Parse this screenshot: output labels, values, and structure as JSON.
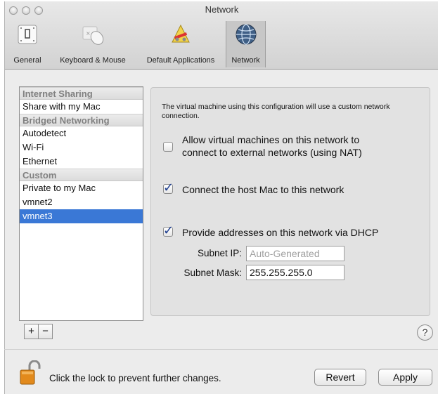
{
  "window": {
    "title": "Network"
  },
  "toolbar": {
    "items": [
      {
        "label": "General",
        "icon": "general-icon"
      },
      {
        "label": "Keyboard & Mouse",
        "icon": "keyboard-mouse-icon"
      },
      {
        "label": "Default Applications",
        "icon": "default-applications-icon"
      },
      {
        "label": "Network",
        "icon": "network-globe-icon",
        "selected": true
      }
    ]
  },
  "network_list": {
    "groups": [
      {
        "header": "Internet Sharing",
        "items": [
          "Share with my Mac"
        ]
      },
      {
        "header": "Bridged Networking",
        "items": [
          "Autodetect",
          "Wi-Fi",
          "Ethernet"
        ]
      },
      {
        "header": "Custom",
        "items": [
          "Private to my Mac",
          "vmnet2",
          "vmnet3"
        ]
      }
    ],
    "selected": "vmnet3",
    "add_label": "+",
    "remove_label": "−"
  },
  "settings": {
    "description": "The virtual machine using this configuration will use a custom network connection.",
    "options": [
      {
        "label": "Allow virtual machines on this network to connect to external networks (using NAT)",
        "checked": false
      },
      {
        "label": "Connect the host Mac to this network",
        "checked": true
      },
      {
        "label": "Provide addresses on this network via DHCP",
        "checked": true
      }
    ],
    "subnet_ip_label": "Subnet IP:",
    "subnet_ip_placeholder": "Auto-Generated",
    "subnet_mask_label": "Subnet Mask:",
    "subnet_mask_value": "255.255.255.0",
    "checkmark": "✓"
  },
  "footer": {
    "help_label": "?",
    "lock_text": "Click the lock to prevent further changes.",
    "revert_label": "Revert",
    "apply_label": "Apply"
  },
  "colors": {
    "selection": "#3a78d6",
    "lock_body": "#e28a1c"
  }
}
